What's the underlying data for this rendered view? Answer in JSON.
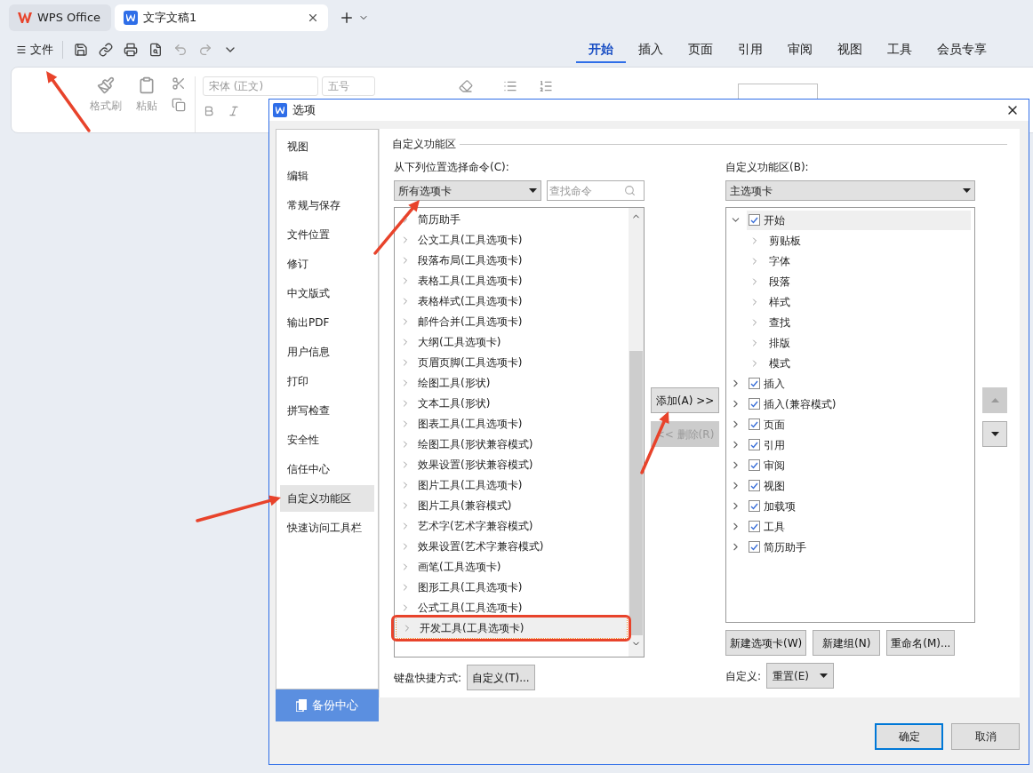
{
  "app_tabs": [
    {
      "label": "WPS Office",
      "kind": "home",
      "selected": false
    },
    {
      "label": "文字文稿1",
      "kind": "doc",
      "selected": true
    }
  ],
  "file_menu": "文件",
  "ribbon_tabs": [
    {
      "label": "开始",
      "selected": true
    },
    {
      "label": "插入",
      "selected": false
    },
    {
      "label": "页面",
      "selected": false
    },
    {
      "label": "引用",
      "selected": false
    },
    {
      "label": "审阅",
      "selected": false
    },
    {
      "label": "视图",
      "selected": false
    },
    {
      "label": "工具",
      "selected": false
    },
    {
      "label": "会员专享",
      "selected": false
    }
  ],
  "ribbon": {
    "format_painter": "格式刷",
    "paste": "粘贴",
    "font": "宋体 (正文)",
    "size": "五号"
  },
  "dialog": {
    "title": "选项",
    "nav": [
      {
        "label": "视图",
        "selected": false
      },
      {
        "label": "编辑",
        "selected": false
      },
      {
        "label": "常规与保存",
        "selected": false
      },
      {
        "label": "文件位置",
        "selected": false
      },
      {
        "label": "修订",
        "selected": false
      },
      {
        "label": "中文版式",
        "selected": false
      },
      {
        "label": "输出PDF",
        "selected": false
      },
      {
        "label": "用户信息",
        "selected": false
      },
      {
        "label": "打印",
        "selected": false
      },
      {
        "label": "拼写检查",
        "selected": false
      },
      {
        "label": "安全性",
        "selected": false
      },
      {
        "label": "信任中心",
        "selected": false
      },
      {
        "label": "自定义功能区",
        "selected": true
      },
      {
        "label": "快速访问工具栏",
        "selected": false
      }
    ],
    "backup_button": "备份中心",
    "section_title": "自定义功能区",
    "commands": {
      "label": "从下列位置选择命令(C):",
      "source": "所有选项卡",
      "search_placeholder": "查找命令",
      "items": [
        {
          "label": "简历助手",
          "selected": false,
          "highlighted": false
        },
        {
          "label": "公文工具(工具选项卡)",
          "selected": false,
          "highlighted": false
        },
        {
          "label": "段落布局(工具选项卡)",
          "selected": false,
          "highlighted": false
        },
        {
          "label": "表格工具(工具选项卡)",
          "selected": false,
          "highlighted": false
        },
        {
          "label": "表格样式(工具选项卡)",
          "selected": false,
          "highlighted": false
        },
        {
          "label": "邮件合并(工具选项卡)",
          "selected": false,
          "highlighted": false
        },
        {
          "label": "大纲(工具选项卡)",
          "selected": false,
          "highlighted": false
        },
        {
          "label": "页眉页脚(工具选项卡)",
          "selected": false,
          "highlighted": false
        },
        {
          "label": "绘图工具(形状)",
          "selected": false,
          "highlighted": false
        },
        {
          "label": "文本工具(形状)",
          "selected": false,
          "highlighted": false
        },
        {
          "label": "图表工具(工具选项卡)",
          "selected": false,
          "highlighted": false
        },
        {
          "label": "绘图工具(形状兼容模式)",
          "selected": false,
          "highlighted": false
        },
        {
          "label": "效果设置(形状兼容模式)",
          "selected": false,
          "highlighted": false
        },
        {
          "label": "图片工具(工具选项卡)",
          "selected": false,
          "highlighted": false
        },
        {
          "label": "图片工具(兼容模式)",
          "selected": false,
          "highlighted": false
        },
        {
          "label": "艺术字(艺术字兼容模式)",
          "selected": false,
          "highlighted": false
        },
        {
          "label": "效果设置(艺术字兼容模式)",
          "selected": false,
          "highlighted": false
        },
        {
          "label": "画笔(工具选项卡)",
          "selected": false,
          "highlighted": false
        },
        {
          "label": "图形工具(工具选项卡)",
          "selected": false,
          "highlighted": false
        },
        {
          "label": "公式工具(工具选项卡)",
          "selected": false,
          "highlighted": false
        },
        {
          "label": "开发工具(工具选项卡)",
          "selected": true,
          "highlighted": true
        }
      ],
      "add_button": {
        "label": "添加(A) >>",
        "disabled": false
      },
      "remove_button": {
        "label": "<< 删除(R)",
        "disabled": true
      },
      "keyboard_label": "键盘快捷方式:",
      "keyboard_button": "自定义(T)..."
    },
    "ribbon_tree": {
      "label": "自定义功能区(B):",
      "source": "主选项卡",
      "items": [
        {
          "label": "开始",
          "checked": true,
          "expanded": true,
          "selected": true,
          "children": [
            {
              "label": "剪贴板"
            },
            {
              "label": "字体"
            },
            {
              "label": "段落"
            },
            {
              "label": "样式"
            },
            {
              "label": "查找"
            },
            {
              "label": "排版"
            },
            {
              "label": "模式"
            }
          ]
        },
        {
          "label": "插入",
          "checked": true,
          "expanded": false,
          "selected": false
        },
        {
          "label": "插入(兼容模式)",
          "checked": true,
          "expanded": false,
          "selected": false
        },
        {
          "label": "页面",
          "checked": true,
          "expanded": false,
          "selected": false
        },
        {
          "label": "引用",
          "checked": true,
          "expanded": false,
          "selected": false
        },
        {
          "label": "审阅",
          "checked": true,
          "expanded": false,
          "selected": false
        },
        {
          "label": "视图",
          "checked": true,
          "expanded": false,
          "selected": false
        },
        {
          "label": "加载项",
          "checked": true,
          "expanded": false,
          "selected": false
        },
        {
          "label": "工具",
          "checked": true,
          "expanded": false,
          "selected": false
        },
        {
          "label": "简历助手",
          "checked": true,
          "expanded": false,
          "selected": false
        }
      ],
      "move_up": {
        "disabled": true
      },
      "move_down": {
        "disabled": false
      },
      "buttons": [
        "新建选项卡(W)",
        "新建组(N)",
        "重命名(M)..."
      ],
      "reset_label": "自定义:",
      "reset_button": "重置(E)"
    },
    "ok_button": "确定",
    "cancel_button": "取消"
  }
}
